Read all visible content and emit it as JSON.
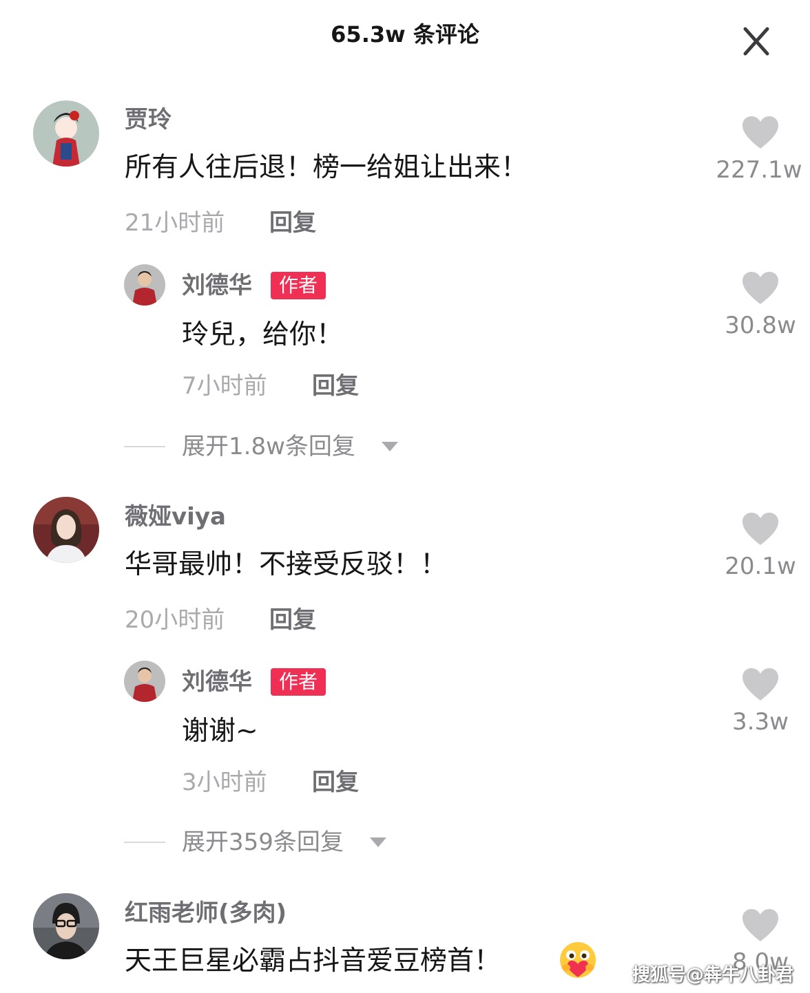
{
  "header": {
    "title": "65.3w 条评论"
  },
  "comments": [
    {
      "user": "贾玲",
      "text": "所有人往后退！榜一给姐让出来！",
      "time": "21小时前",
      "reply_label": "回复",
      "likes": "227.1w",
      "reply": {
        "user": "刘德华",
        "badge": "作者",
        "text": "玲兒，给你！",
        "time": "7小时前",
        "reply_label": "回复",
        "likes": "30.8w"
      },
      "expand_label": "展开1.8w条回复"
    },
    {
      "user": "薇娅viya",
      "text": "华哥最帅！不接受反驳！！",
      "time": "20小时前",
      "reply_label": "回复",
      "likes": "20.1w",
      "reply": {
        "user": "刘德华",
        "badge": "作者",
        "text": "谢谢~",
        "time": "3小时前",
        "reply_label": "回复",
        "likes": "3.3w"
      },
      "expand_label": "展开359条回复"
    },
    {
      "user": "红雨老师(多肉)",
      "text": "天王巨星必霸占抖音爱豆榜首！",
      "emoji": "hugging-heart-emoji",
      "likes": "8.0w"
    }
  ],
  "watermark": "搜狐号@犇牛八卦君",
  "colors": {
    "author_badge": "#f02f55",
    "username": "#6e6e73",
    "timestamp": "#a9a9ae",
    "like_icon": "#c9c9cc"
  },
  "icons": [
    "close-icon",
    "heart-icon",
    "caret-down-icon"
  ]
}
